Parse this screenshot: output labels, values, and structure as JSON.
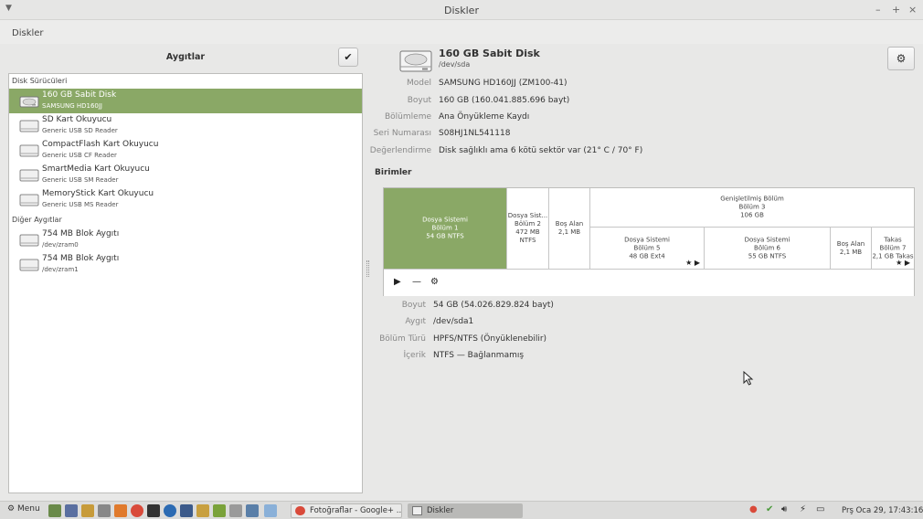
{
  "window": {
    "title": "Diskler",
    "app_name": "Diskler",
    "controls": [
      "–",
      "+",
      "×"
    ]
  },
  "devices_panel": {
    "title": "Aygıtlar",
    "sections": [
      {
        "label": "Disk Sürücüleri",
        "items": [
          {
            "name": "160 GB Sabit Disk",
            "sub": "SAMSUNG HD160JJ",
            "selected": true
          },
          {
            "name": "SD Kart Okuyucu",
            "sub": "Generic USB SD Reader"
          },
          {
            "name": "CompactFlash Kart Okuyucu",
            "sub": "Generic USB CF Reader"
          },
          {
            "name": "SmartMedia Kart Okuyucu",
            "sub": "Generic USB SM Reader"
          },
          {
            "name": "MemoryStick Kart Okuyucu",
            "sub": "Generic USB MS Reader"
          }
        ]
      },
      {
        "label": "Diğer Aygıtlar",
        "items": [
          {
            "name": "754 MB Blok Aygıtı",
            "sub": "/dev/zram0"
          },
          {
            "name": "754 MB Blok Aygıtı",
            "sub": "/dev/zram1"
          }
        ]
      }
    ]
  },
  "disk": {
    "title": "160 GB Sabit Disk",
    "device": "/dev/sda",
    "properties": [
      {
        "label": "Model",
        "value": "SAMSUNG HD160JJ (ZM100-41)"
      },
      {
        "label": "Boyut",
        "value": "160 GB (160.041.885.696 bayt)"
      },
      {
        "label": "Bölümleme",
        "value": "Ana Önyükleme Kaydı"
      },
      {
        "label": "Seri Numarası",
        "value": "S08HJ1NL541118"
      },
      {
        "label": "Değerlendirme",
        "value": "Disk sağlıklı ama 6 kötü sektör var (21° C / 70° F)"
      }
    ]
  },
  "volumes": {
    "title": "Birimler",
    "top_row": [
      {
        "lines": [
          "Dosya Sistemi",
          "Bölüm 1",
          "54 GB NTFS"
        ],
        "selected": true
      },
      {
        "lines": [
          "Dosya Sist...",
          "Bölüm 2",
          "472 MB NTFS"
        ]
      },
      {
        "lines": [
          "Boş Alan",
          "2,1 MB"
        ]
      },
      {
        "lines": [
          "Genişletilmiş Bölüm",
          "Bölüm 3",
          "106 GB"
        ]
      }
    ],
    "logical": [
      {
        "lines": [
          "Dosya Sistemi",
          "Bölüm 5",
          "48 GB Ext4"
        ],
        "flags": "★ ▶"
      },
      {
        "lines": [
          "Dosya Sistemi",
          "Bölüm 6",
          "55 GB NTFS"
        ]
      },
      {
        "lines": [
          "Boş Alan",
          "2,1 MB"
        ]
      },
      {
        "lines": [
          "Takas",
          "Bölüm 7",
          "2,1 GB Takas"
        ],
        "flags": "★ ▶"
      }
    ],
    "toolbar": {
      "play": "▶",
      "minus": "—",
      "gears": "⚙"
    }
  },
  "selected_volume": {
    "properties": [
      {
        "label": "Boyut",
        "value": "54 GB (54.026.829.824 bayt)"
      },
      {
        "label": "Aygıt",
        "value": "/dev/sda1"
      },
      {
        "label": "Bölüm Türü",
        "value": "HPFS/NTFS (Önyüklenebilir)"
      },
      {
        "label": "İçerik",
        "value": "NTFS — Bağlanmamış"
      }
    ]
  },
  "taskbar": {
    "menu_label": "Menu",
    "tasks": [
      {
        "label": "Fotoğraflar - Google+ ...",
        "icon": "chrome-icon"
      },
      {
        "label": "Diskler",
        "icon": "disks-icon",
        "active": true
      }
    ],
    "clock": "Prş Oca 29, 17:43:16"
  },
  "colors": {
    "selection": "#8aa866",
    "panel_bg": "#e8e8e7"
  }
}
